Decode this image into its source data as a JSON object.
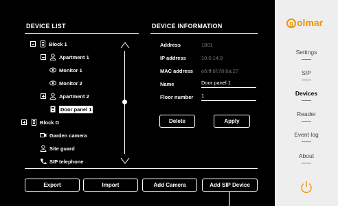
{
  "device_list": {
    "title": "DEVICE LIST",
    "items": [
      {
        "label": "Block 1",
        "icon": "building-icon",
        "expander": "minus"
      },
      {
        "label": "Apartment 1",
        "icon": "person-icon",
        "expander": "minus"
      },
      {
        "label": "Monitor 1",
        "icon": "eye-icon",
        "expander": ""
      },
      {
        "label": "Monitor 2",
        "icon": "eye-icon",
        "expander": ""
      },
      {
        "label": "Apartment 2",
        "icon": "person-icon",
        "expander": "plus"
      },
      {
        "label": "Door panel 1",
        "icon": "door-panel-icon",
        "expander": "",
        "selected": true
      },
      {
        "label": "Block D",
        "icon": "building-icon",
        "expander": "plus"
      },
      {
        "label": "Garden camera",
        "icon": "camera-icon",
        "expander": ""
      },
      {
        "label": "Site guard",
        "icon": "person-icon",
        "expander": ""
      },
      {
        "label": "SIP telephone",
        "icon": "phone-icon",
        "expander": ""
      }
    ]
  },
  "device_info": {
    "title": "DEVICE INFORMATION",
    "address_label": "Address",
    "address_value": "1801",
    "ip_label": "IP address",
    "ip_value": "10.0.14.9",
    "mac_label": "MAC address",
    "mac_value": "e6:ff:6f:78:6a:27",
    "name_label": "Name",
    "name_value": "Door panel 1",
    "floor_label": "Floor number",
    "floor_value": "1",
    "delete_label": "Delete",
    "apply_label": "Apply"
  },
  "actions": {
    "export_label": "Export",
    "import_label": "Import",
    "add_camera_label": "Add Camera",
    "add_sip_label": "Add SIP Device"
  },
  "sidebar": {
    "logo_text": "olmar",
    "logo_letter": "g",
    "items": [
      {
        "label": "Settings"
      },
      {
        "label": "SIP"
      },
      {
        "label": "Devices",
        "active": true
      },
      {
        "label": "Reader"
      },
      {
        "label": "Event log"
      },
      {
        "label": "About"
      }
    ]
  },
  "colors": {
    "accent": "#f29100",
    "sidebar_bg": "#eeeeee",
    "main_bg": "#000000"
  }
}
